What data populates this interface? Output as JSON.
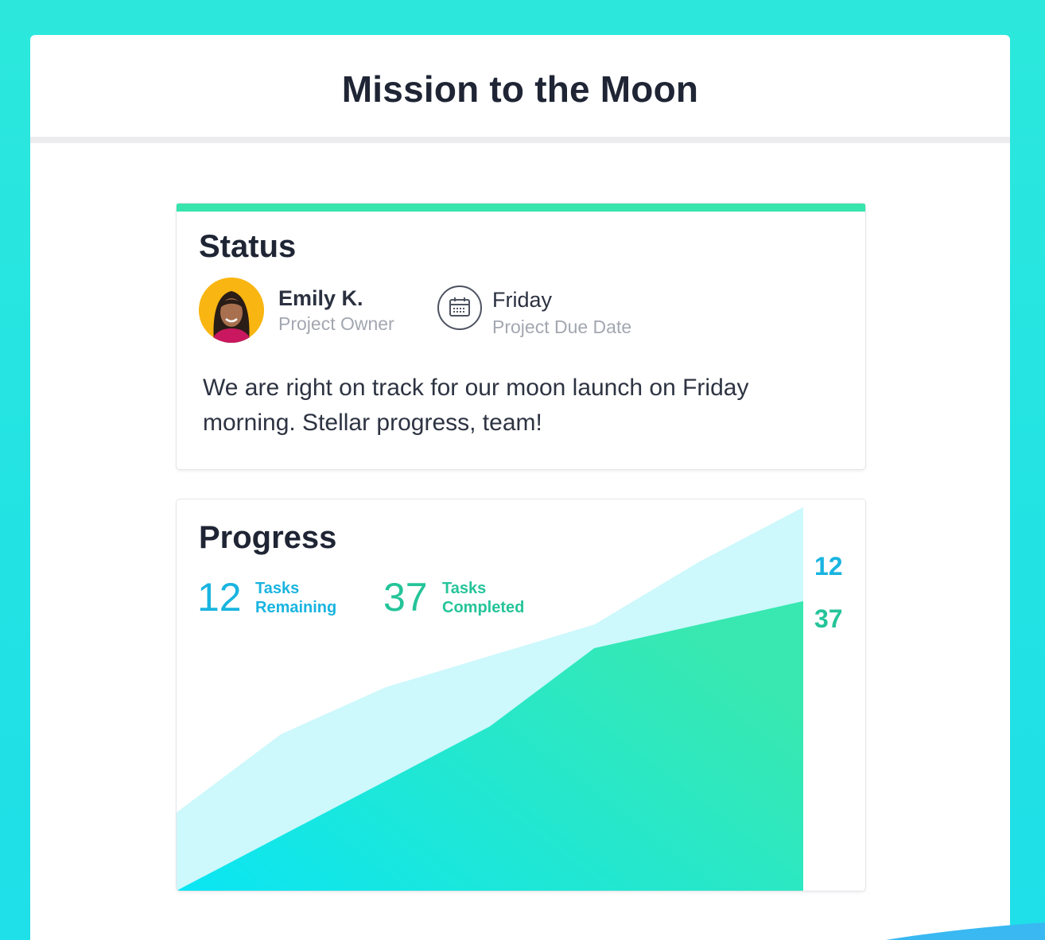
{
  "page": {
    "title": "Mission to the Moon"
  },
  "status": {
    "heading": "Status",
    "owner_name": "Emily K.",
    "owner_role": "Project Owner",
    "due_date": "Friday",
    "due_label": "Project Due Date",
    "message": "We are right on track for our moon launch on Friday morning. Stellar progress, team!",
    "icons": {
      "avatar": "avatar",
      "calendar": "calendar-icon"
    }
  },
  "progress": {
    "heading": "Progress",
    "remaining_count": "12",
    "remaining_label": "Tasks Remaining",
    "completed_count": "37",
    "completed_label": "Tasks Completed",
    "end_label_remaining": "12",
    "end_label_completed": "37"
  },
  "colors": {
    "background": "#26e5e0",
    "accent_green": "#36e4ac",
    "remaining_blue": "#19b4e0",
    "completed_green": "#25c49a",
    "remaining_area": "#cdf8fc"
  },
  "chart_data": {
    "type": "area",
    "stacked": true,
    "x": [
      0,
      1,
      2,
      3,
      4,
      5,
      6
    ],
    "series": [
      {
        "name": "Tasks Completed",
        "values": [
          0,
          7,
          14,
          21,
          31,
          34,
          37
        ]
      },
      {
        "name": "Tasks Remaining",
        "values": [
          10,
          13,
          12,
          9,
          3,
          8,
          12
        ]
      }
    ],
    "ylim": [
      0,
      50
    ],
    "grid": false,
    "legend": "none"
  }
}
